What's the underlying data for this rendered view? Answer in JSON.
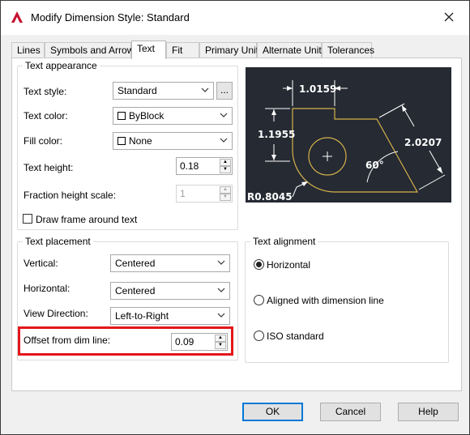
{
  "window": {
    "title": "Modify Dimension Style: Standard",
    "close_glyph": "✕"
  },
  "tabs": [
    {
      "label": "Lines"
    },
    {
      "label": "Symbols and Arrows"
    },
    {
      "label": "Text"
    },
    {
      "label": "Fit"
    },
    {
      "label": "Primary Units"
    },
    {
      "label": "Alternate Units"
    },
    {
      "label": "Tolerances"
    }
  ],
  "active_tab": "Text",
  "text_appearance": {
    "group_label": "Text appearance",
    "text_style_label": "Text style:",
    "text_style_value": "Standard",
    "browse_label": "...",
    "text_color_label": "Text color:",
    "text_color_value": "ByBlock",
    "fill_color_label": "Fill color:",
    "fill_color_value": "None",
    "text_height_label": "Text height:",
    "text_height_value": "0.18",
    "fraction_height_label": "Fraction height scale:",
    "fraction_height_value": "1",
    "draw_frame_label": "Draw frame around text",
    "draw_frame_checked": false
  },
  "preview": {
    "dim_top": "1.0159",
    "dim_left": "1.1955",
    "dim_right": "2.0207",
    "dim_angle": "60°",
    "dim_radius": "R0.8045",
    "colors": {
      "background": "#252a33",
      "geometry": "#d6b24a",
      "dimensions": "#ffffff"
    }
  },
  "text_placement": {
    "group_label": "Text placement",
    "vertical_label": "Vertical:",
    "vertical_value": "Centered",
    "horizontal_label": "Horizontal:",
    "horizontal_value": "Centered",
    "view_direction_label": "View Direction:",
    "view_direction_value": "Left-to-Right",
    "offset_label": "Offset from dim line:",
    "offset_value": "0.09"
  },
  "text_alignment": {
    "group_label": "Text alignment",
    "options": [
      {
        "label": "Horizontal",
        "selected": true
      },
      {
        "label": "Aligned with dimension line",
        "selected": false
      },
      {
        "label": "ISO standard",
        "selected": false
      }
    ]
  },
  "buttons": {
    "ok": "OK",
    "cancel": "Cancel",
    "help": "Help"
  },
  "colors": {
    "highlight": "#e3161b",
    "app_logo": "#c8102e",
    "default_button_border": "#0078d7"
  }
}
